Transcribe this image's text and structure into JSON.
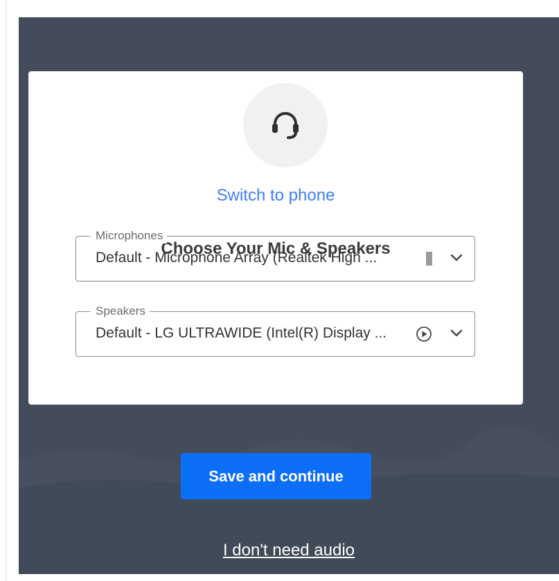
{
  "icons": {
    "headset": "headset-icon",
    "play": "play-icon",
    "chevron": "chevron-down-icon",
    "level": "audio-level-icon"
  },
  "colors": {
    "background": "#444c5b",
    "card": "#ffffff",
    "link": "#3d7ef0",
    "primary_button": "#0d6ef8"
  },
  "card": {
    "switch_link": "Switch to phone",
    "heading": "Choose Your Mic & Speakers"
  },
  "microphones": {
    "label": "Microphones",
    "value": "Default - Microphone Array (Realtek High ..."
  },
  "speakers": {
    "label": "Speakers",
    "value": "Default - LG ULTRAWIDE (Intel(R) Display ..."
  },
  "actions": {
    "save_label": "Save and continue",
    "no_audio_label": "I don't need audio"
  }
}
